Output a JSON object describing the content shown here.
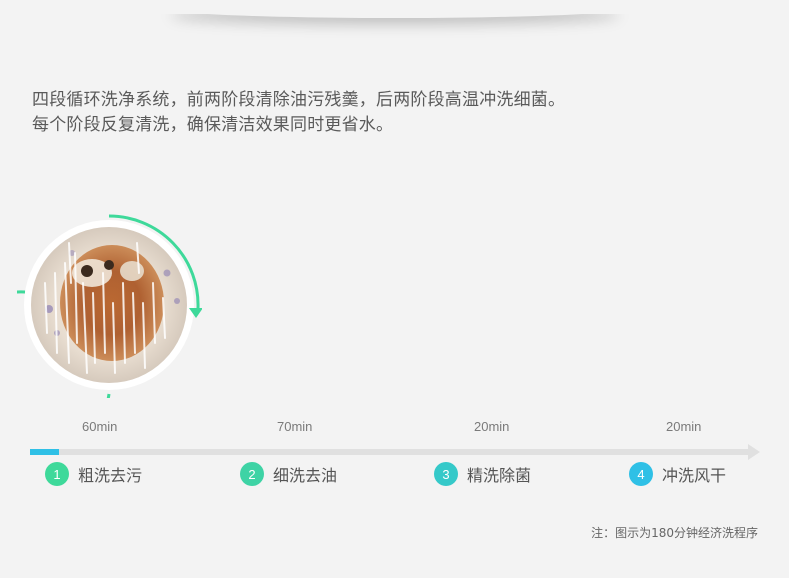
{
  "intro": {
    "line1": "四段循环洗净系统，前两阶段清除油污残羹，后两阶段高温冲洗细菌。",
    "line2": "每个阶段反复清洗，确保清洁效果同时更省水。"
  },
  "timeline": {
    "progress_fraction": 0.04,
    "colors": {
      "track": "#e0e0e0",
      "fill": "#2fc0e6",
      "ring": "#3ed99a"
    },
    "stages": [
      {
        "time": "60min",
        "number": "1",
        "label": "粗洗去污",
        "color": "#3ed99a"
      },
      {
        "time": "70min",
        "number": "2",
        "label": "细洗去油",
        "color": "#3ed3a5"
      },
      {
        "time": "20min",
        "number": "3",
        "label": "精洗除菌",
        "color": "#35c9c9"
      },
      {
        "time": "20min",
        "number": "4",
        "label": "冲洗风干",
        "color": "#2fc0e6"
      }
    ]
  },
  "note": "注：图示为180分钟经济洗程序"
}
